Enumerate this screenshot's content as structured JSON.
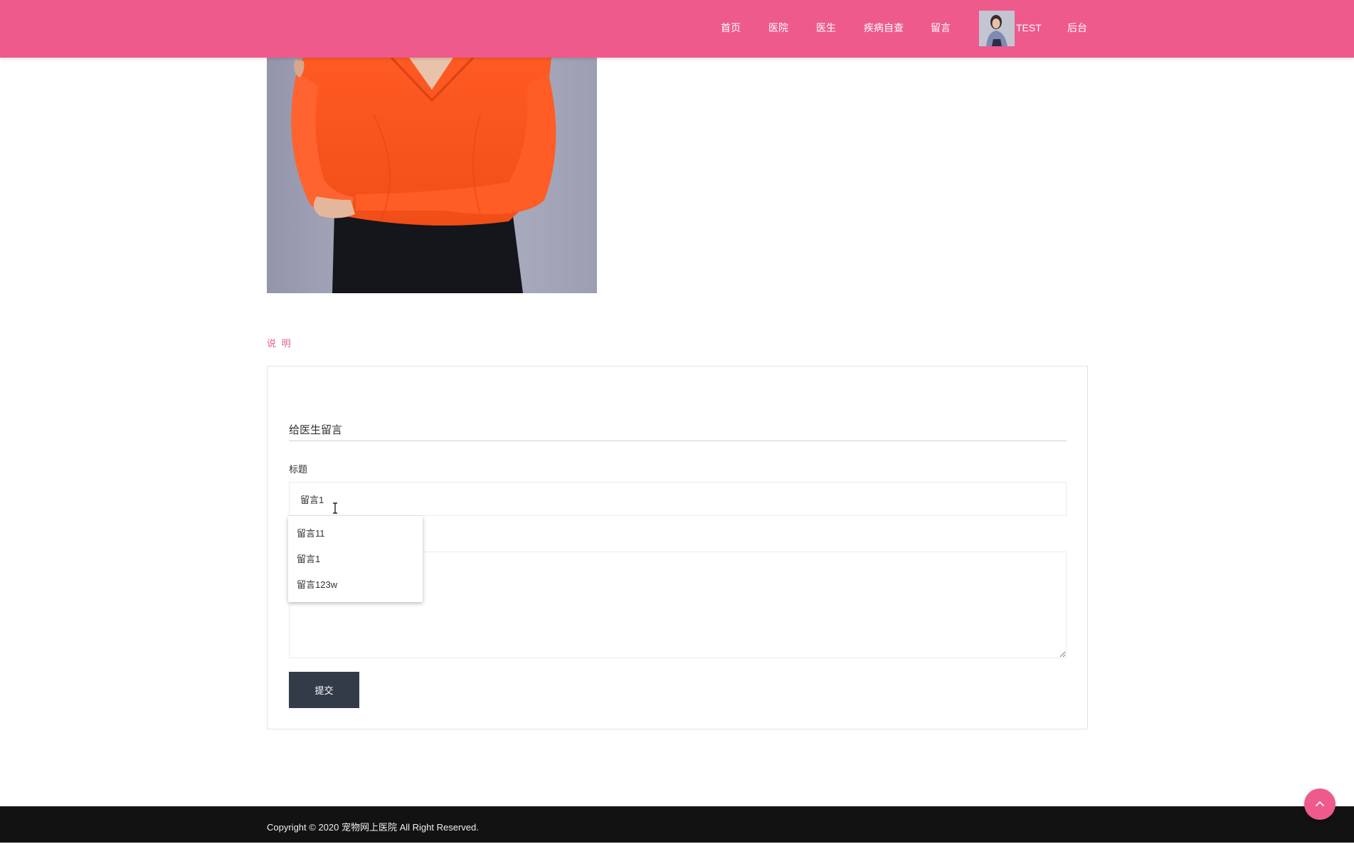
{
  "nav": {
    "items": [
      {
        "label": "首页"
      },
      {
        "label": "医院"
      },
      {
        "label": "医生"
      },
      {
        "label": "疾病自查"
      },
      {
        "label": "留言"
      }
    ],
    "user_name": "TEST",
    "admin_label": "后台"
  },
  "section": {
    "label": "说 明"
  },
  "form": {
    "title": "给医生留言",
    "title_field_label": "标题",
    "title_value": "留言1",
    "submit_label": "提交"
  },
  "autocomplete": {
    "options": [
      "留言11",
      "留言1",
      "留言123w"
    ]
  },
  "footer": {
    "copyright": "Copyright © 2020 宠物网上医院 All Right Reserved."
  },
  "colors": {
    "header": "#ee5a8c",
    "accent_text": "#e0608c",
    "submit_button": "#343b48",
    "footer": "#121212"
  },
  "icons": {
    "back_to_top": "chevron-up-icon"
  }
}
